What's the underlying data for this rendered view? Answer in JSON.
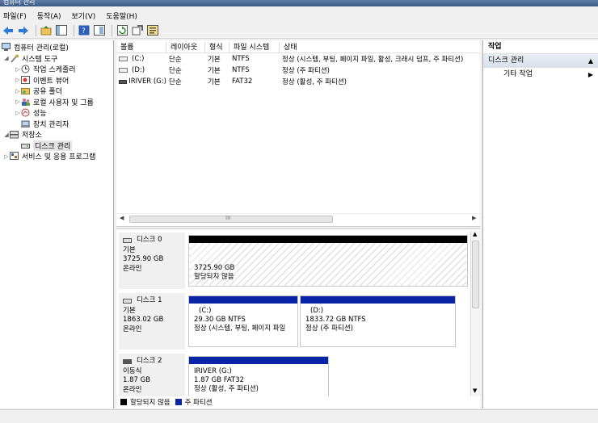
{
  "window": {
    "title": "컴퓨터 관리"
  },
  "menu": [
    "파일(F)",
    "동작(A)",
    "보기(V)",
    "도움말(H)"
  ],
  "toolbar": {
    "icons": [
      "back-icon",
      "forward-icon",
      "up-icon",
      "show-hide-tree-icon",
      "help-icon",
      "properties-icon",
      "refresh-icon",
      "export-icon",
      "wizard-icon"
    ]
  },
  "tree": {
    "root": "컴퓨터 관리(로컬)",
    "system_tools": "시스템 도구",
    "task_scheduler": "작업 스케줄러",
    "event_viewer": "이벤트 뷰어",
    "shared_folders": "공유 폴더",
    "local_users": "로컬 사용자 및 그룹",
    "performance": "성능",
    "device_manager": "장치 관리자",
    "storage": "저장소",
    "disk_management": "디스크 관리",
    "services": "서비스 및 응용 프로그램"
  },
  "volume_table": {
    "headers": [
      "볼륨",
      "레이아웃",
      "형식",
      "파일 시스템",
      "상태"
    ],
    "rows": [
      {
        "volume": "(C:)",
        "layout": "단순",
        "type": "기본",
        "fs": "NTFS",
        "status": "정상 (시스템, 부팅, 페이지 파일, 활성, 크래시 덤프, 주 파티션)"
      },
      {
        "volume": "(D:)",
        "layout": "단순",
        "type": "기본",
        "fs": "NTFS",
        "status": "정상 (주 파티션)"
      },
      {
        "volume": "IRIVER (G:)",
        "layout": "단순",
        "type": "기본",
        "fs": "FAT32",
        "status": "정상 (활성, 주 파티션)"
      }
    ]
  },
  "hscroll_grip": "III",
  "disks": [
    {
      "name": "디스크 0",
      "kind": "기본",
      "size": "3725.90 GB",
      "state": "온라인",
      "partitions": [
        {
          "label": "",
          "size": "3725.90 GB",
          "status": "할당되지 않음"
        }
      ]
    },
    {
      "name": "디스크 1",
      "kind": "기본",
      "size": "1863.02 GB",
      "state": "온라인",
      "partitions": [
        {
          "label": "(C:)",
          "size": "29.30 GB NTFS",
          "status": "정상 (시스템, 부팅, 페이지 파일"
        },
        {
          "label": "(D:)",
          "size": "1833.72 GB NTFS",
          "status": "정상 (주 파티션)"
        }
      ]
    },
    {
      "name": "디스크 2",
      "kind": "이동식",
      "size": "1.87 GB",
      "state": "온라인",
      "partitions": [
        {
          "label": "IRIVER  (G:)",
          "size": "1.87 GB FAT32",
          "status": "정상 (활성, 주 파티션)"
        }
      ]
    }
  ],
  "legend": [
    {
      "label": "할당되지 않음",
      "color": "#000000"
    },
    {
      "label": "주 파티션",
      "color": "#0a24a8"
    }
  ],
  "actions": {
    "header": "작업",
    "section": "디스크 관리",
    "more": "기타 작업"
  },
  "colors": {
    "primary_partition": "#0a24a8",
    "unallocated": "#000000"
  }
}
